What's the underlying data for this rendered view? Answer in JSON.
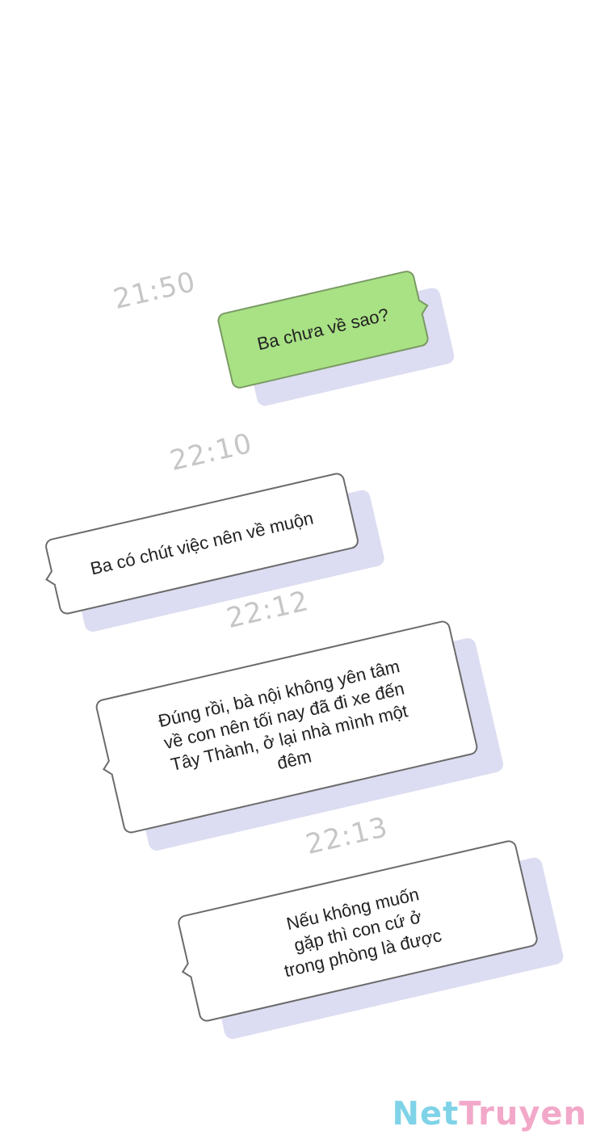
{
  "timestamps": [
    "21:50",
    "22:10",
    "22:12",
    "22:13"
  ],
  "messages": [
    {
      "text": "Ba chưa về sao?",
      "sender": "me"
    },
    {
      "text": "Ba có chút việc nên về muộn",
      "sender": "other"
    },
    {
      "text": "Đúng rồi, bà nội không yên tâm về con nên tối nay đã đi xe đến Tây Thành, ở lại nhà mình một đêm",
      "sender": "other"
    },
    {
      "text": "Nếu không muốn gặp thì con cứ ở trong phòng là được",
      "sender": "other"
    }
  ],
  "watermark": {
    "part1": "Net",
    "part2": "Truyen"
  },
  "colors": {
    "outgoing_bubble": "#a9e285",
    "incoming_bubble": "#ffffff",
    "timestamp": "#c6c6c6"
  }
}
